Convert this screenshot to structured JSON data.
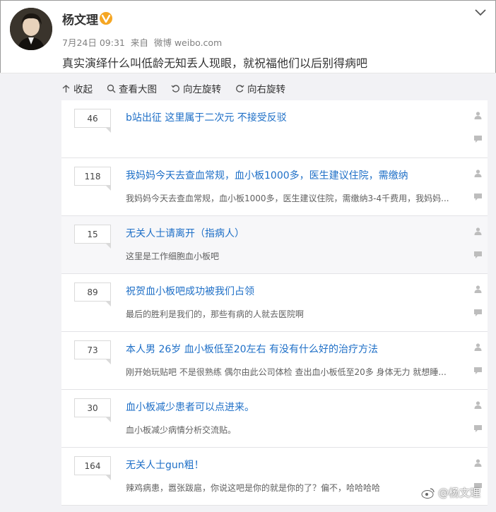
{
  "post": {
    "author": "杨文理",
    "date": "7月24日 09:31",
    "source_prefix": "来自",
    "source": "微博 weibo.com",
    "text": "真实演绎什么叫低龄无知丢人现眼，就祝福他们以后别得病吧"
  },
  "toolbar": {
    "collapse": "收起",
    "view_large": "查看大图",
    "rotate_left": "向左旋转",
    "rotate_right": "向右旋转"
  },
  "threads": [
    {
      "count": "46",
      "title": "b站出征 这里属于二次元 不接受反驳",
      "desc": ""
    },
    {
      "count": "118",
      "title": "我妈妈今天去查血常规，血小板1000多，医生建议住院，需缴纳",
      "desc": "我妈妈今天去查血常规，血小板1000多，医生建议住院，需缴纳3-4千费用，我妈妈..."
    },
    {
      "count": "15",
      "title": "无关人士请离开（指病人）",
      "desc": "这里是工作细胞血小板吧"
    },
    {
      "count": "89",
      "title": "祝贺血小板吧成功被我们占领",
      "desc": "最后的胜利是我们的，那些有病的人就去医院啊"
    },
    {
      "count": "73",
      "title": "本人男 26岁 血小板低至20左右 有没有什么好的治疗方法",
      "desc": "刚开始玩贴吧 不是很熟练 偶尔由此公司体检 查出血小板低至20多 身体无力 就想睡..."
    },
    {
      "count": "30",
      "title": "血小板减少患者可以点进来。",
      "desc": "血小板减少病情分析交流贴。"
    },
    {
      "count": "164",
      "title": "无关人士gun粗！",
      "desc": "辣鸡病患，嚣张跋扈，你说这吧是你的就是你的了？偏不，哈哈哈哈"
    }
  ],
  "watermark": "@杨文理",
  "colors": {
    "link": "#1e6fc7",
    "panel_bg": "#f2f2f5",
    "verified": "#f5a623"
  }
}
